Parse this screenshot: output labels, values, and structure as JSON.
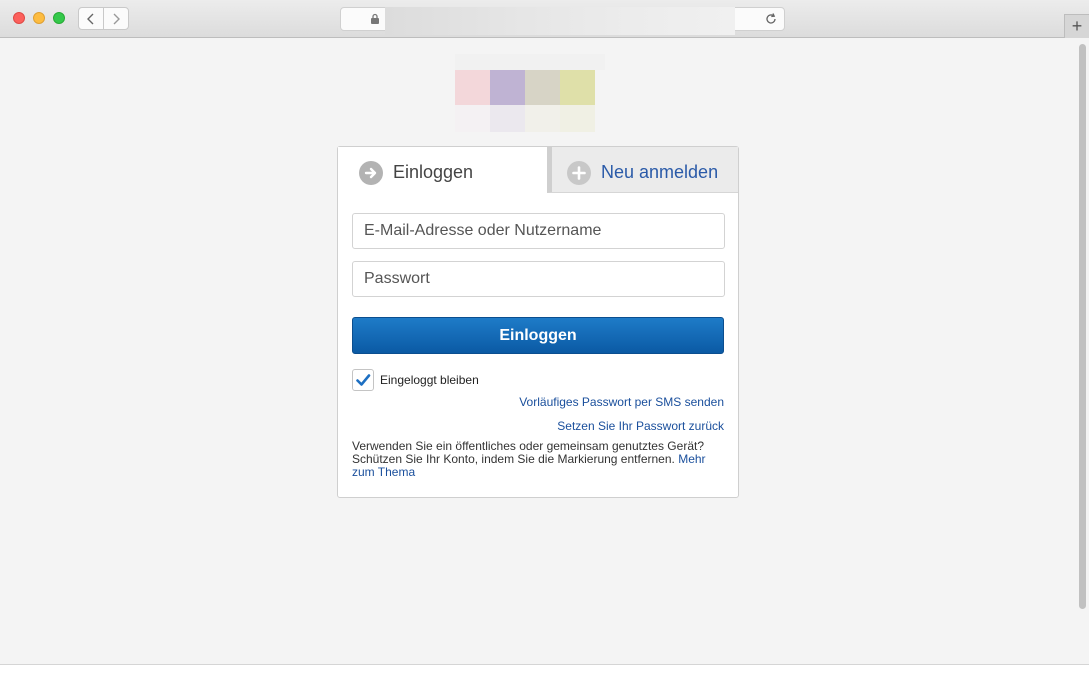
{
  "browser": {
    "tab_new_label": "+"
  },
  "tabs": {
    "login_label": "Einloggen",
    "register_label": "Neu anmelden"
  },
  "form": {
    "email_placeholder": "E-Mail-Adresse oder Nutzername",
    "email_value": "",
    "password_placeholder": "Passwort",
    "password_value": "",
    "submit_label": "Einloggen",
    "remember_label": "Eingeloggt bleiben",
    "remember_checked": true
  },
  "links": {
    "sms": "Vorläufiges Passwort per SMS senden",
    "reset": "Setzen Sie Ihr Passwort zurück"
  },
  "info": {
    "text": "Verwenden Sie ein öffentliches oder gemeinsam genutztes Gerät? Schützen Sie Ihr Konto, indem Sie die Markierung entfernen.",
    "more_link": "Mehr zum Thema"
  },
  "colors": {
    "primary": "#0b5aa4",
    "link": "#1a4f9c",
    "logo": [
      "#f3d7da",
      "#bfb3d3",
      "#d7d4c6",
      "#dfe0a9",
      "#f4f1f3",
      "#ebe8ee",
      "#f1f0ea",
      "#f0f0e4"
    ]
  },
  "icons": {
    "login_tab": "arrow-right-circle-icon",
    "register_tab": "plus-circle-icon",
    "checkbox": "checkmark-icon"
  }
}
